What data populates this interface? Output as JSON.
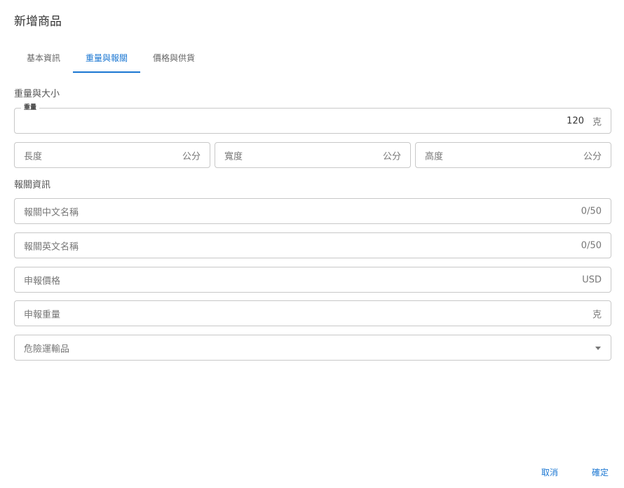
{
  "dialog": {
    "title": "新增商品"
  },
  "tabs": [
    {
      "label": "基本資訊"
    },
    {
      "label": "重量與報關"
    },
    {
      "label": "價格與供貨"
    }
  ],
  "weight_size": {
    "section_title": "重量與大小",
    "weight": {
      "label": "重量",
      "value": "120",
      "suffix": "克"
    },
    "length": {
      "placeholder": "長度",
      "suffix": "公分"
    },
    "width": {
      "placeholder": "寬度",
      "suffix": "公分"
    },
    "height": {
      "placeholder": "高度",
      "suffix": "公分"
    }
  },
  "customs": {
    "section_title": "報關資訊",
    "name_zh": {
      "placeholder": "報關中文名稱",
      "counter": "0/50"
    },
    "name_en": {
      "placeholder": "報關英文名稱",
      "counter": "0/50"
    },
    "declared_price": {
      "placeholder": "申報價格",
      "suffix": "USD"
    },
    "declared_weight": {
      "placeholder": "申報重量",
      "suffix": "克"
    },
    "dangerous_goods": {
      "placeholder": "危險運輸品"
    }
  },
  "footer": {
    "cancel_label": "取消",
    "confirm_label": "確定"
  }
}
